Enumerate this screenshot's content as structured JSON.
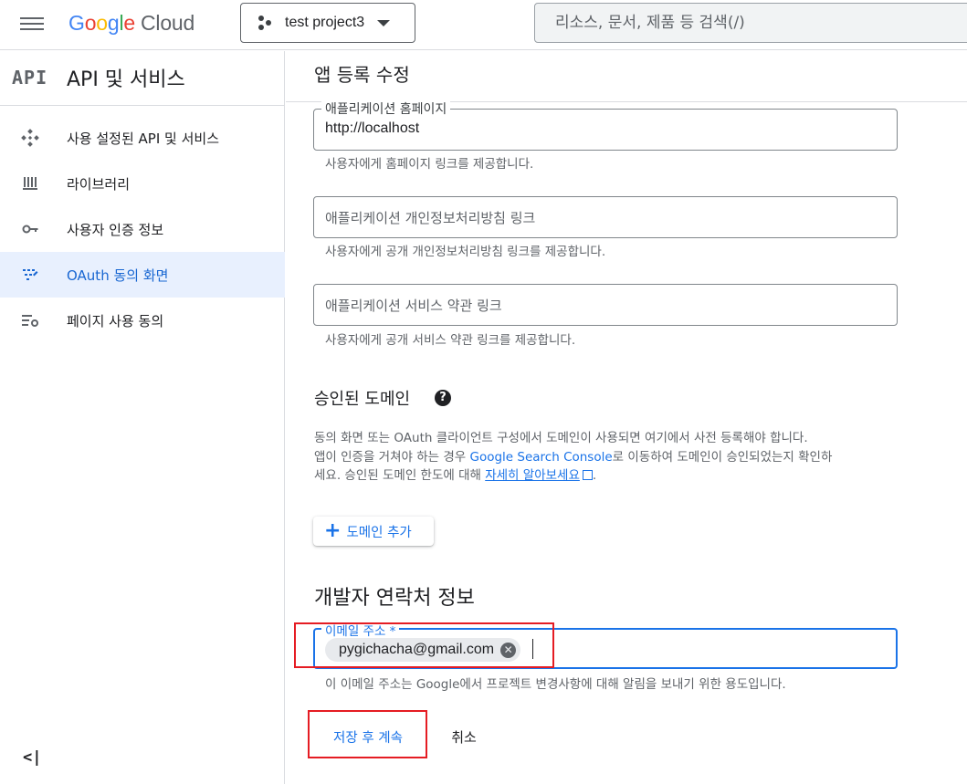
{
  "header": {
    "brand": {
      "g": "G",
      "o1": "o",
      "o2": "o",
      "g2": "g",
      "l": "l",
      "e": "e",
      "cloud": "Cloud"
    },
    "project": "test project3",
    "search_placeholder": "리소스, 문서, 제품 등 검색(/)"
  },
  "sidebar": {
    "badge": "API",
    "title": "API 및 서비스",
    "items": [
      {
        "label": "사용 설정된 API 및 서비스",
        "icon": "api-diamond-icon",
        "active": false
      },
      {
        "label": "라이브러리",
        "icon": "library-icon",
        "active": false
      },
      {
        "label": "사용자 인증 정보",
        "icon": "key-icon",
        "active": false
      },
      {
        "label": "OAuth 동의 화면",
        "icon": "consent-icon",
        "active": true
      },
      {
        "label": "페이지 사용 동의",
        "icon": "settings-list-icon",
        "active": false
      }
    ],
    "collapse": "<|"
  },
  "main": {
    "title": "앱 등록 수정",
    "homepage": {
      "legend": "애플리케이션 홈페이지",
      "value": "http://localhost",
      "hint": "사용자에게 홈페이지 링크를 제공합니다."
    },
    "privacy": {
      "placeholder": "애플리케이션 개인정보처리방침 링크",
      "hint": "사용자에게 공개 개인정보처리방침 링크를 제공합니다."
    },
    "tos": {
      "placeholder": "애플리케이션 서비스 약관 링크",
      "hint": "사용자에게 공개 서비스 약관 링크를 제공합니다."
    },
    "authorized_domains": {
      "heading": "승인된 도메인",
      "help": "?",
      "para1": "동의 화면 또는 OAuth 클라이언트 구성에서 도메인이 사용되면 여기에서 사전 등록해야 합니다.",
      "para2_a": "앱이 인증을 거쳐야 하는 경우 ",
      "para2_link": "Google Search Console",
      "para2_b": "로 이동하여 도메인이 승인되었는지 확인하",
      "para3_a": "세요. 승인된 도메인 한도에 대해 ",
      "para3_link": "자세히 알아보세요",
      "para3_b": ".",
      "add_button": "도메인 추가"
    },
    "developer_contact": {
      "heading": "개발자 연락처 정보",
      "email_legend": "이메일 주소 *",
      "email_chip": "pygichacha@gmail.com",
      "hint": "이 이메일 주소는 Google에서 프로젝트 변경사항에 대해 알림을 보내기 위한 용도입니다."
    },
    "buttons": {
      "save": "저장 후 계속",
      "cancel": "취소"
    }
  },
  "colors": {
    "accent": "#1a73e8",
    "active_bg": "#e8f0fe",
    "highlight": "#e51c23"
  }
}
